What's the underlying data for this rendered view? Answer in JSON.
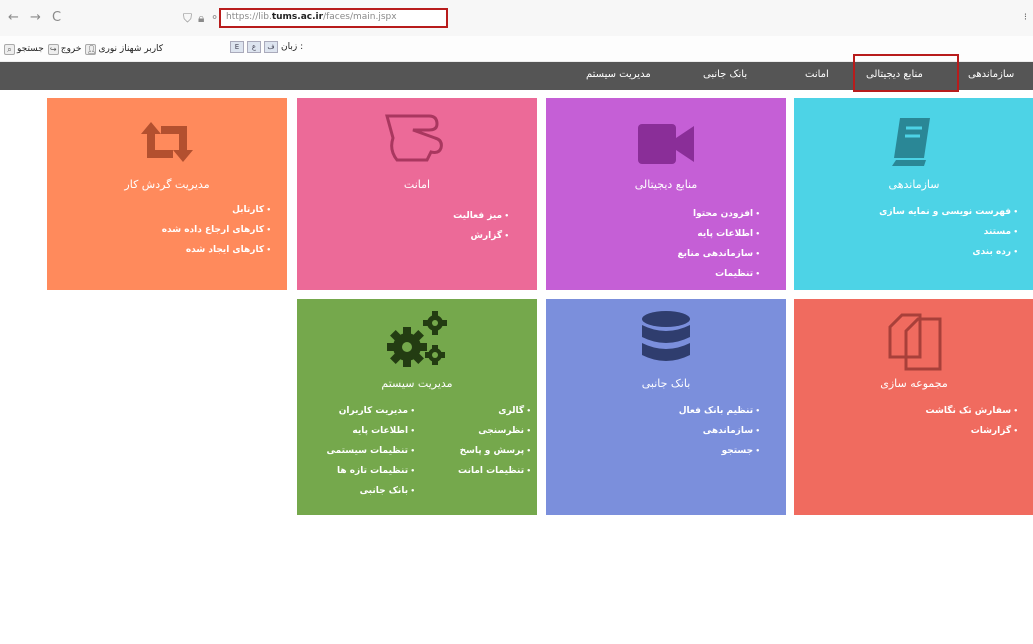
{
  "browser": {
    "back": "←",
    "forward": "→",
    "reload": "C",
    "url_prefix": "https://lib.",
    "url_host": "tums.ac.ir",
    "url_path": "/faces/main.jspx"
  },
  "util": {
    "search_label": "جستجو",
    "logout_label": "خروج",
    "user_label": "کاربر شهناز نوری",
    "language_label": "زبان :",
    "lang_buttons": [
      "E",
      "ع",
      "ف"
    ]
  },
  "nav": {
    "items": [
      "سازماندهی",
      "منابع دیجیتالی",
      "امانت",
      "بانک جانبی",
      "مدیریت سیستم"
    ]
  },
  "tiles": {
    "organizing": {
      "title": "سازماندهی",
      "color": "#4dd3e6",
      "links": [
        "فهرست نویسی و نمایه سازی",
        "مستند",
        "رده بندی"
      ]
    },
    "digital": {
      "title": "منابع دیجیتالی",
      "color": "#c55fd6",
      "links": [
        "افزودن محتوا",
        "اطلاعات پایه",
        "سازماندهی منابع",
        "تنظیمات"
      ]
    },
    "circulation": {
      "title": "امانت",
      "color": "#ec6a98",
      "links": [
        "میز فعالیت",
        "گزارش"
      ]
    },
    "workflow": {
      "title": "مدیریت گردش کار",
      "color": "#ff8a5c",
      "links": [
        "کارتابل",
        "کارهای ارجاع داده شده",
        "کارهای ایجاد شده"
      ]
    },
    "collection": {
      "title": "مجموعه سازی",
      "color": "#f06b5f",
      "links": [
        "سفارش تک نگاشت",
        "گزارشات"
      ]
    },
    "bank": {
      "title": "بانک جانبی",
      "color": "#7b8fdc",
      "links": [
        "تنظیم بانک فعال",
        "سازماندهی",
        "جستجو"
      ]
    },
    "system": {
      "title": "مدیریت سیستم",
      "color": "#75a84c",
      "links_right": [
        "گالری",
        "نظرسنجی",
        "پرسش و پاسخ",
        "تنظیمات امانت"
      ],
      "links_left": [
        "مدیریت کاربران",
        "اطلاعات پایه",
        "تنظیمات سیستمی",
        "تنظیمات تازه ها",
        "بانک جانبی"
      ]
    }
  }
}
